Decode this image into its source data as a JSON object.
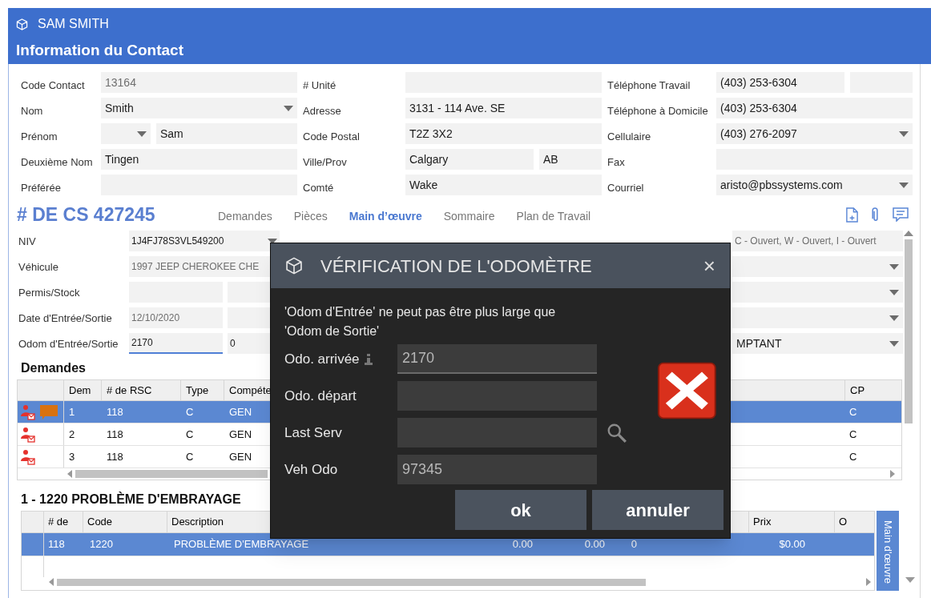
{
  "window": {
    "title": "SAM SMITH",
    "heading": "Information du Contact"
  },
  "contact": [
    [
      {
        "label": "Code Contact",
        "fields": [
          {
            "kind": "text",
            "value": "13164",
            "readonly": true
          }
        ]
      },
      {
        "label": "Nom",
        "fields": [
          {
            "kind": "dropdown",
            "value": "Smith"
          }
        ]
      },
      {
        "label": "Prénom",
        "fields": [
          {
            "kind": "dropdown"
          },
          {
            "kind": "text",
            "value": "Sam"
          }
        ]
      },
      {
        "label": "Deuxième Nom",
        "fields": [
          {
            "kind": "text",
            "value": "Tingen"
          }
        ]
      },
      {
        "label": "Préférée",
        "fields": [
          {
            "kind": "text"
          }
        ]
      }
    ],
    [
      {
        "label": "# Unité",
        "fields": [
          {
            "kind": "text"
          }
        ]
      },
      {
        "label": "Adresse",
        "fields": [
          {
            "kind": "text",
            "value": "3131 - 114 Ave. SE"
          }
        ]
      },
      {
        "label": "Code Postal",
        "fields": [
          {
            "kind": "text",
            "value": "T2Z 3X2"
          }
        ]
      },
      {
        "label": "Ville/Prov",
        "fields": [
          {
            "kind": "text",
            "value": "Calgary"
          },
          {
            "kind": "text",
            "value": "AB"
          }
        ]
      },
      {
        "label": "Comté",
        "fields": [
          {
            "kind": "text",
            "value": "Wake"
          }
        ]
      }
    ],
    [
      {
        "label": "Téléphone Travail",
        "fields": [
          {
            "kind": "text",
            "value": "(403) 253-6304"
          },
          {
            "kind": "text"
          }
        ]
      },
      {
        "label": "Téléphone à Domicile",
        "fields": [
          {
            "kind": "text",
            "value": "(403) 253-6304"
          }
        ]
      },
      {
        "label": "Cellulaire",
        "fields": [
          {
            "kind": "dropdown",
            "value": "(403) 276-2097"
          }
        ]
      },
      {
        "label": "Fax",
        "fields": [
          {
            "kind": "text"
          }
        ]
      },
      {
        "label": "Courriel",
        "fields": [
          {
            "kind": "dropdown",
            "value": "aristo@pbssystems.com"
          }
        ]
      }
    ]
  ],
  "order": {
    "number": "# DE CS 427245",
    "tabs": [
      {
        "label": "Demandes",
        "selected": false
      },
      {
        "label": "Pièces",
        "selected": false
      },
      {
        "label": "Main d’œuvre",
        "selected": true
      },
      {
        "label": "Sommaire",
        "selected": false
      },
      {
        "label": "Plan de Travail",
        "selected": false
      }
    ]
  },
  "vehicle": [
    {
      "label": "NIV",
      "fields": [
        {
          "kind": "dropdown",
          "value": "1J4FJ78S3VL549200"
        }
      ]
    },
    {
      "label": "Véhicule",
      "fields": [
        {
          "kind": "text",
          "value": "1997 JEEP CHEROKEE CHE",
          "readonly": true
        }
      ]
    },
    {
      "label": "Permis/Stock",
      "fields": [
        {
          "kind": "text"
        },
        {
          "kind": "text"
        }
      ]
    },
    {
      "label": "Date d'Entrée/Sortie",
      "fields": [
        {
          "kind": "text",
          "value": "12/10/2020",
          "readonly": true
        },
        {
          "kind": "text"
        }
      ]
    },
    {
      "label": "Odom d'Entrée/Sortie",
      "fields": [
        {
          "kind": "text",
          "value": "2170",
          "focused": true
        },
        {
          "kind": "text",
          "value": "0"
        }
      ]
    }
  ],
  "vehicle_right": [
    {
      "kind": "text",
      "value": "C - Ouvert, W - Ouvert, I - Ouvert",
      "readonly": true
    },
    {
      "kind": "dropdown"
    },
    {
      "kind": "dropdown"
    },
    {
      "kind": "dropdown"
    },
    {
      "kind": "dropdown",
      "value": "MPTANT"
    }
  ],
  "requests": {
    "title": "Demandes",
    "columns": [
      "Dem",
      "# de RSC",
      "Type",
      "Compéte",
      "CP"
    ],
    "rows": [
      {
        "selected": true,
        "comment": true,
        "cells": [
          "1",
          "118",
          "C",
          "GEN",
          "C"
        ]
      },
      {
        "selected": false,
        "comment": false,
        "cells": [
          "2",
          "118",
          "C",
          "GEN",
          "C"
        ]
      },
      {
        "selected": false,
        "comment": false,
        "cells": [
          "3",
          "118",
          "C",
          "GEN",
          "C"
        ]
      }
    ]
  },
  "labor": {
    "title": "1 - 1220 PROBLÈME D'EMBRAYAGE",
    "columns": [
      "# de",
      "Code",
      "Description",
      "Prix",
      "O"
    ],
    "rows": [
      {
        "selected": true,
        "cells": [
          "118",
          "1220",
          "PROBLÈME D'EMBRAYAGE",
          "0.00",
          "0.00",
          "0",
          "$0.00"
        ]
      }
    ],
    "side_tab": "Main d'œuvre"
  },
  "dialog": {
    "title": "VÉRIFICATION DE L'ODOMÈTRE",
    "close": "×",
    "message": "'Odom d'Entrée' ne peut pas être plus large que 'Odom de Sortie'",
    "fields": [
      {
        "label": "Odo. arrivée",
        "value": "2170",
        "kind": "info"
      },
      {
        "label": "Odo. départ",
        "kind": "plain"
      },
      {
        "label": "Last Serv",
        "kind": "search"
      },
      {
        "label": "Veh Odo",
        "value": "97345",
        "kind": "plain"
      }
    ],
    "buttons": [
      "ok",
      "annuler"
    ]
  }
}
